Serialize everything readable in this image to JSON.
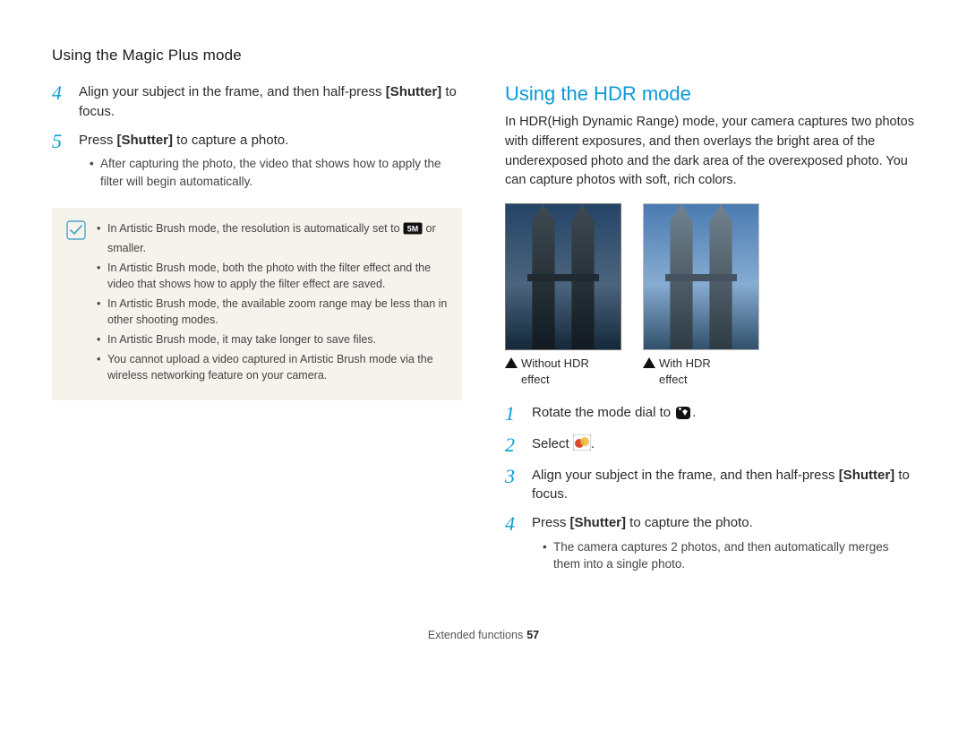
{
  "header": "Using the Magic Plus mode",
  "left": {
    "steps": [
      {
        "n": "4",
        "text_a": "Align your subject in the frame, and then half-press ",
        "bold": "[Shutter]",
        "text_b": " to focus."
      },
      {
        "n": "5",
        "text_a": "Press ",
        "bold": "[Shutter]",
        "text_b": " to capture a photo.",
        "sub": [
          "After capturing the photo, the video that shows how to apply the filter will begin automatically."
        ]
      }
    ],
    "note_items": [
      {
        "pre": "In Artistic Brush mode, the resolution is automatically set to ",
        "icon": "5M",
        "post": " or smaller."
      },
      {
        "pre": "In Artistic Brush mode, both the photo with the filter effect and the video that shows how to apply the filter effect are saved."
      },
      {
        "pre": "In Artistic Brush mode, the available zoom range may be less than in other shooting modes."
      },
      {
        "pre": "In Artistic Brush mode, it may take longer to save files."
      },
      {
        "pre": "You cannot upload a video captured in Artistic Brush mode via the wireless networking feature on your camera."
      }
    ]
  },
  "right": {
    "title": "Using the HDR mode",
    "intro": "In HDR(High Dynamic Range) mode, your camera captures two photos with different exposures, and then overlays the bright area of the underexposed photo and the dark area of the overexposed photo. You can capture photos with soft, rich colors.",
    "captions": {
      "a1": "Without HDR",
      "a2": "effect",
      "b1": "With HDR",
      "b2": "effect"
    },
    "steps": [
      {
        "n": "1",
        "text_a": "Rotate the mode dial to ",
        "icon": "mode-dial",
        "text_b": "."
      },
      {
        "n": "2",
        "text_a": "Select ",
        "icon": "hdr-select",
        "text_b": "."
      },
      {
        "n": "3",
        "text_a": "Align your subject in the frame, and then half-press ",
        "bold": "[Shutter]",
        "text_b": " to focus."
      },
      {
        "n": "4",
        "text_a": "Press ",
        "bold": "[Shutter]",
        "text_b": " to capture the photo.",
        "sub": [
          "The camera captures 2 photos, and then automatically merges them into a single photo."
        ]
      }
    ]
  },
  "footer": {
    "label": "Extended functions",
    "page": "57"
  }
}
